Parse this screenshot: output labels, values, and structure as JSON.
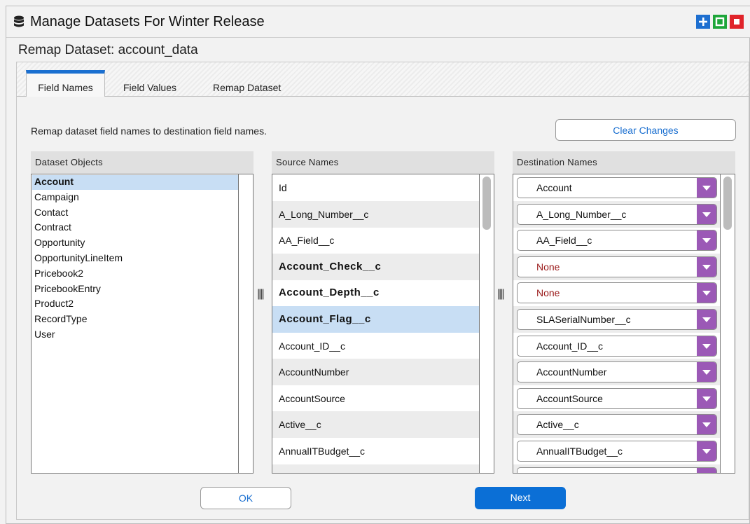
{
  "window": {
    "title": "Manage Datasets For Winter Release",
    "icon": "database-icon",
    "controls": [
      "maximize-icon",
      "restore-icon",
      "close-icon"
    ],
    "control_colors": {
      "maximize": "#1e6fd0",
      "restore": "#1ea63a",
      "close": "#e0242a"
    }
  },
  "subtitle": "Remap Dataset: account_data",
  "tabs": [
    {
      "label": "Field Names",
      "active": true
    },
    {
      "label": "Field Values",
      "active": false
    },
    {
      "label": "Remap Dataset",
      "active": false
    }
  ],
  "description": "Remap dataset field names to destination field names.",
  "clear_button": "Clear Changes",
  "dataset_objects": {
    "header": "Dataset Objects",
    "items": [
      "Account",
      "Campaign",
      "Contact",
      "Contract",
      "Opportunity",
      "OpportunityLineItem",
      "Pricebook2",
      "PricebookEntry",
      "Product2",
      "RecordType",
      "User"
    ],
    "selected": "Account"
  },
  "source_names": {
    "header": "Source Names",
    "rows": [
      {
        "name": "Id",
        "bold": false,
        "selected": false
      },
      {
        "name": "A_Long_Number__c",
        "bold": false,
        "selected": false
      },
      {
        "name": "AA_Field__c",
        "bold": false,
        "selected": false
      },
      {
        "name": "Account_Check__c",
        "bold": true,
        "selected": false
      },
      {
        "name": "Account_Depth__c",
        "bold": true,
        "selected": false
      },
      {
        "name": "Account_Flag__c",
        "bold": true,
        "selected": true
      },
      {
        "name": "Account_ID__c",
        "bold": false,
        "selected": false
      },
      {
        "name": "AccountNumber",
        "bold": false,
        "selected": false
      },
      {
        "name": "AccountSource",
        "bold": false,
        "selected": false
      },
      {
        "name": "Active__c",
        "bold": false,
        "selected": false
      },
      {
        "name": "AnnualITBudget__c",
        "bold": false,
        "selected": false
      }
    ]
  },
  "destination_names": {
    "header": "Destination Names",
    "rows": [
      {
        "value": "Account",
        "none": false
      },
      {
        "value": "A_Long_Number__c",
        "none": false
      },
      {
        "value": "AA_Field__c",
        "none": false
      },
      {
        "value": "None",
        "none": true
      },
      {
        "value": "None",
        "none": true
      },
      {
        "value": "SLASerialNumber__c",
        "none": false
      },
      {
        "value": "Account_ID__c",
        "none": false
      },
      {
        "value": "AccountNumber",
        "none": false
      },
      {
        "value": "AccountSource",
        "none": false
      },
      {
        "value": "Active__c",
        "none": false
      },
      {
        "value": "AnnualITBudget__c",
        "none": false
      }
    ],
    "accent_color": "#9b59b6",
    "none_color": "#9a1a1a"
  },
  "buttons": {
    "ok": "OK",
    "next": "Next"
  },
  "colors": {
    "accent": "#1a6fd0",
    "selection": "#c8def4"
  }
}
